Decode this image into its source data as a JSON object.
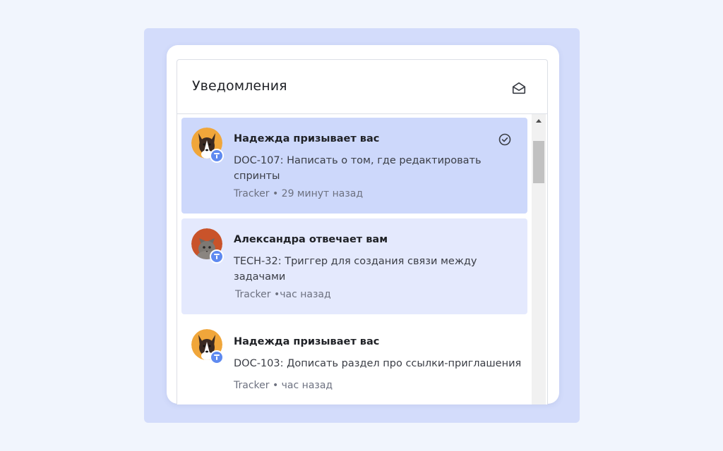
{
  "panel": {
    "title": "Уведомления",
    "mark_all_icon": "envelope-open-icon"
  },
  "notifications": [
    {
      "title": "Надежда призывает вас",
      "body": "DOC-107: Написать о том, где редактировать спринты",
      "meta": "Tracker • 29 минут назад",
      "avatar": "dog-avatar",
      "state": "selected",
      "action_icon": "check-circle-icon"
    },
    {
      "title": "Александра отвечает вам",
      "body": "TECH-32: Триггер для создания связи между задачами",
      "meta": "Tracker •час назад",
      "avatar": "cat-avatar",
      "state": "unread"
    },
    {
      "title": "Надежда призывает вас",
      "body": "DOC-103: Дописать раздел про ссылки-приглашения",
      "meta": "Tracker • час назад",
      "avatar": "dog-avatar",
      "state": "read"
    }
  ],
  "colors": {
    "page_background": "#f1f5fd",
    "frame": "#d3dcfb",
    "selected": "#cdd8fb",
    "unread": "#e4e9fd",
    "badge": "#5f8af0"
  }
}
